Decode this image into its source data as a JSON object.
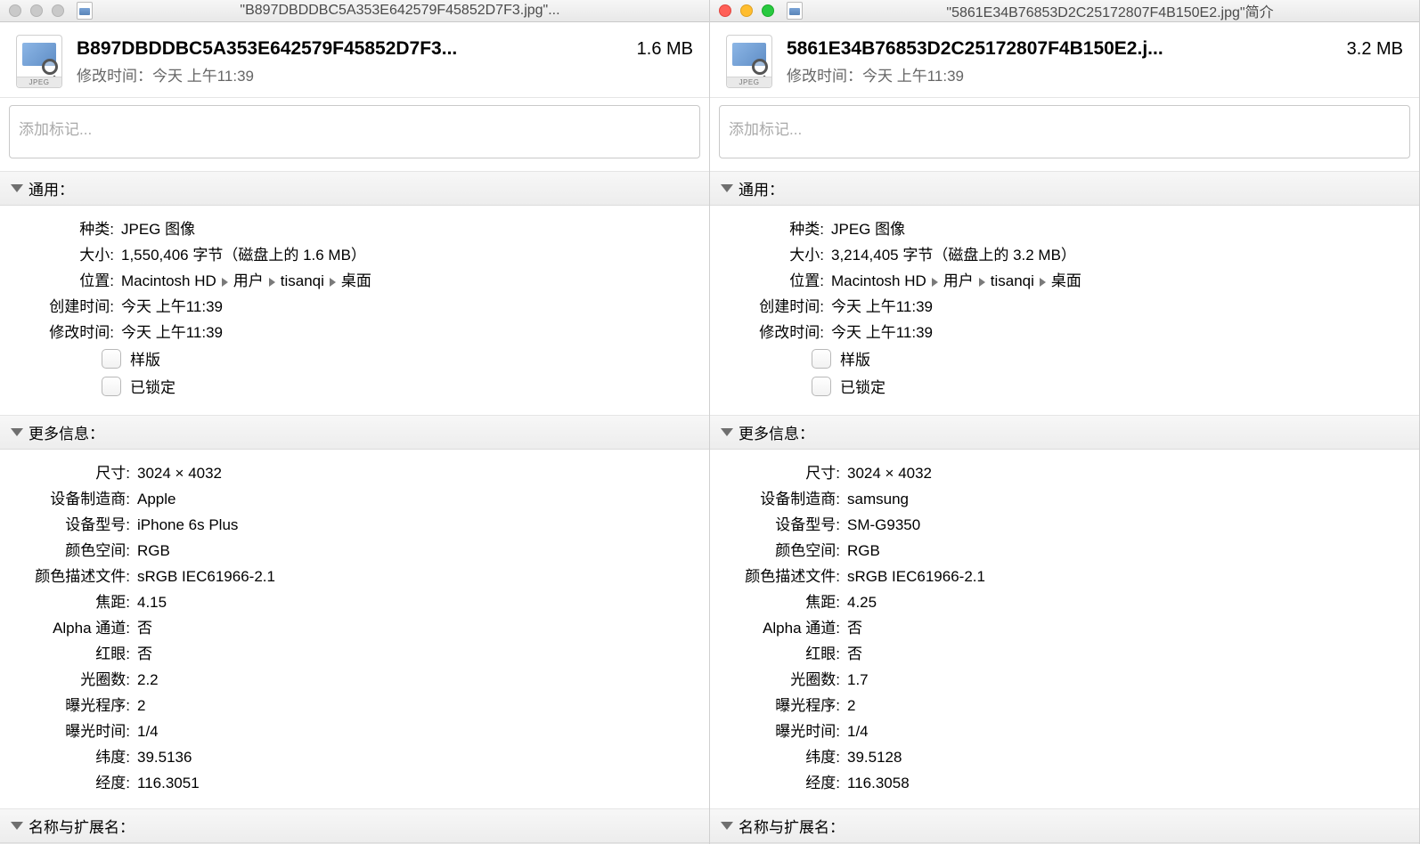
{
  "left": {
    "titlebar": "\"B897DBDDBC5A353E642579F45852D7F3.jpg\"...",
    "filename": "B897DBDDBC5A353E642579F45852D7F3...",
    "filesize": "1.6 MB",
    "mod_label": "修改时间：",
    "mod_value": "今天 上午11:39",
    "tags_placeholder": "添加标记...",
    "icon_caption": "JPEG",
    "sections": {
      "general_title": "通用：",
      "more_title": "更多信息：",
      "name_ext_title": "名称与扩展名："
    },
    "general": {
      "kind_k": "种类",
      "kind_v": "JPEG 图像",
      "size_k": "大小",
      "size_v": "1,550,406 字节（磁盘上的 1.6 MB）",
      "where_k": "位置",
      "created_k": "创建时间",
      "created_v": "今天 上午11:39",
      "modified_k": "修改时间",
      "modified_v": "今天 上午11:39",
      "stationery": "样版",
      "locked": "已锁定",
      "path": [
        "Macintosh HD",
        "用户",
        "tisanqi",
        "桌面"
      ]
    },
    "more": {
      "dim_k": "尺寸",
      "dim_v": "3024 × 4032",
      "make_k": "设备制造商",
      "make_v": "Apple",
      "model_k": "设备型号",
      "model_v": "iPhone 6s Plus",
      "cs_k": "颜色空间",
      "cs_v": "RGB",
      "prof_k": "颜色描述文件",
      "prof_v": "sRGB IEC61966-2.1",
      "fl_k": "焦距",
      "fl_v": "4.15",
      "alpha_k": "Alpha 通道",
      "alpha_v": "否",
      "redeye_k": "红眼",
      "redeye_v": "否",
      "fnum_k": "光圈数",
      "fnum_v": "2.2",
      "prog_k": "曝光程序",
      "prog_v": "2",
      "exp_k": "曝光时间",
      "exp_v": "1/4",
      "lat_k": "纬度",
      "lat_v": "39.5136",
      "lon_k": "经度",
      "lon_v": "116.3051"
    }
  },
  "right": {
    "titlebar": "\"5861E34B76853D2C25172807F4B150E2.jpg\"简介",
    "filename": "5861E34B76853D2C25172807F4B150E2.j...",
    "filesize": "3.2 MB",
    "mod_label": "修改时间：",
    "mod_value": "今天 上午11:39",
    "tags_placeholder": "添加标记...",
    "icon_caption": "JPEG",
    "sections": {
      "general_title": "通用：",
      "more_title": "更多信息：",
      "name_ext_title": "名称与扩展名："
    },
    "general": {
      "kind_k": "种类",
      "kind_v": "JPEG 图像",
      "size_k": "大小",
      "size_v": "3,214,405 字节（磁盘上的 3.2 MB）",
      "where_k": "位置",
      "created_k": "创建时间",
      "created_v": "今天 上午11:39",
      "modified_k": "修改时间",
      "modified_v": "今天 上午11:39",
      "stationery": "样版",
      "locked": "已锁定",
      "path": [
        "Macintosh HD",
        "用户",
        "tisanqi",
        "桌面"
      ]
    },
    "more": {
      "dim_k": "尺寸",
      "dim_v": "3024 × 4032",
      "make_k": "设备制造商",
      "make_v": "samsung",
      "model_k": "设备型号",
      "model_v": "SM-G9350",
      "cs_k": "颜色空间",
      "cs_v": "RGB",
      "prof_k": "颜色描述文件",
      "prof_v": "sRGB IEC61966-2.1",
      "fl_k": "焦距",
      "fl_v": "4.25",
      "alpha_k": "Alpha 通道",
      "alpha_v": "否",
      "redeye_k": "红眼",
      "redeye_v": "否",
      "fnum_k": "光圈数",
      "fnum_v": "1.7",
      "prog_k": "曝光程序",
      "prog_v": "2",
      "exp_k": "曝光时间",
      "exp_v": "1/4",
      "lat_k": "纬度",
      "lat_v": "39.5128",
      "lon_k": "经度",
      "lon_v": "116.3058"
    }
  }
}
